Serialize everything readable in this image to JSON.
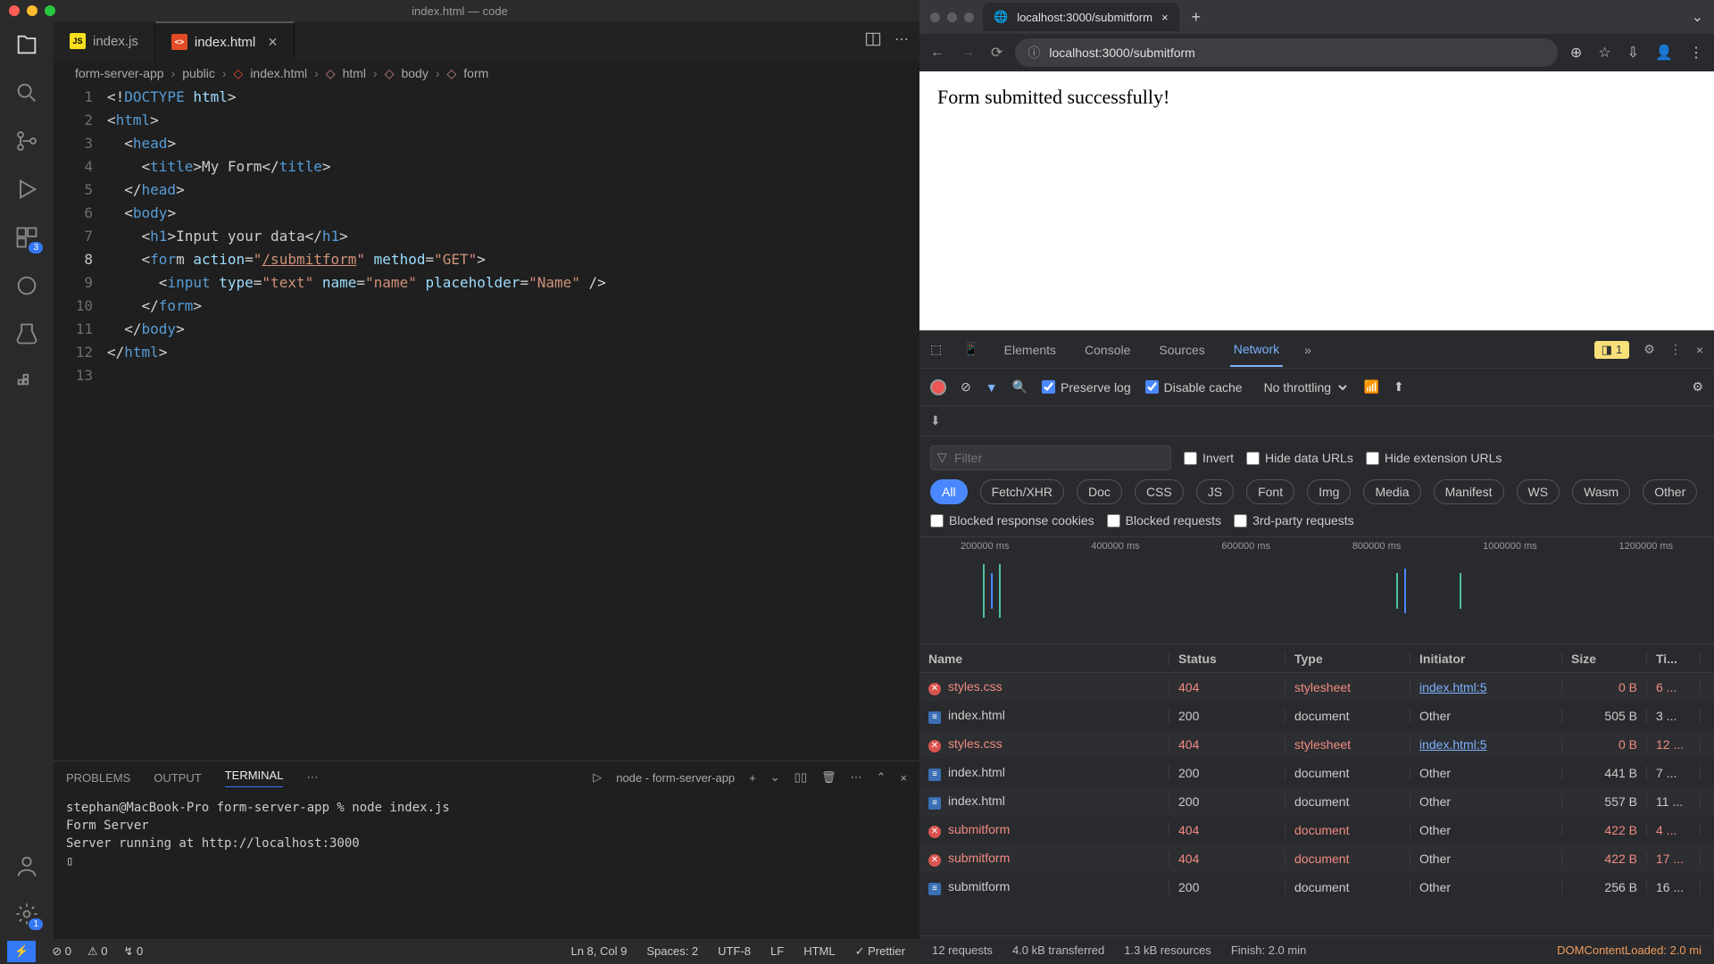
{
  "vscode": {
    "title": "index.html — code",
    "tabs": [
      {
        "icon": "js",
        "label": "index.js",
        "active": false
      },
      {
        "icon": "html",
        "label": "index.html",
        "active": true
      }
    ],
    "breadcrumb": [
      "form-server-app",
      "public",
      "index.html",
      "html",
      "body",
      "form"
    ],
    "code_lines": [
      "1",
      "2",
      "3",
      "4",
      "5",
      "6",
      "7",
      "8",
      "9",
      "10",
      "11",
      "12",
      "13"
    ],
    "panel_tabs": [
      "PROBLEMS",
      "OUTPUT",
      "TERMINAL",
      "⋯"
    ],
    "terminal_label": "node - form-server-app",
    "terminal_text": "stephan@MacBook-Pro form-server-app % node index.js\nForm Server\nServer running at http://localhost:3000\n▯",
    "status_left": {
      "errors": "0",
      "warnings": "0",
      "ports": "0"
    },
    "status_right": {
      "pos": "Ln 8, Col 9",
      "spaces": "Spaces: 2",
      "enc": "UTF-8",
      "eol": "LF",
      "lang": "HTML",
      "prettier": "Prettier"
    },
    "badge_scm": "3",
    "badge_settings": "1"
  },
  "browser": {
    "tab_title": "localhost:3000/submitform",
    "url": "localhost:3000/submitform",
    "content": "Form submitted successfully!"
  },
  "devtools": {
    "tabs": [
      "Elements",
      "Console",
      "Sources",
      "Network"
    ],
    "active_tab": "Network",
    "msg_count": "1",
    "preserve_log": "Preserve log",
    "disable_cache": "Disable cache",
    "throttling": "No throttling",
    "filter_placeholder": "Filter",
    "filter_opts": [
      "Invert",
      "Hide data URLs",
      "Hide extension URLs"
    ],
    "types": [
      "All",
      "Fetch/XHR",
      "Doc",
      "CSS",
      "JS",
      "Font",
      "Img",
      "Media",
      "Manifest",
      "WS",
      "Wasm",
      "Other"
    ],
    "blocked_opts": [
      "Blocked response cookies",
      "Blocked requests",
      "3rd-party requests"
    ],
    "timeline_marks": [
      "200000 ms",
      "400000 ms",
      "600000 ms",
      "800000 ms",
      "1000000 ms",
      "1200000 ms"
    ],
    "columns": [
      "Name",
      "Status",
      "Type",
      "Initiator",
      "Size",
      "Ti..."
    ],
    "rows": [
      {
        "name": "styles.css",
        "status": "404",
        "type": "stylesheet",
        "initiator": "index.html:5",
        "size": "0 B",
        "time": "6 ...",
        "err": true
      },
      {
        "name": "index.html",
        "status": "200",
        "type": "document",
        "initiator": "Other",
        "size": "505 B",
        "time": "3 ...",
        "err": false
      },
      {
        "name": "styles.css",
        "status": "404",
        "type": "stylesheet",
        "initiator": "index.html:5",
        "size": "0 B",
        "time": "12 ...",
        "err": true
      },
      {
        "name": "index.html",
        "status": "200",
        "type": "document",
        "initiator": "Other",
        "size": "441 B",
        "time": "7 ...",
        "err": false
      },
      {
        "name": "index.html",
        "status": "200",
        "type": "document",
        "initiator": "Other",
        "size": "557 B",
        "time": "11 ...",
        "err": false
      },
      {
        "name": "submitform",
        "status": "404",
        "type": "document",
        "initiator": "Other",
        "size": "422 B",
        "time": "4 ...",
        "err": true
      },
      {
        "name": "submitform",
        "status": "404",
        "type": "document",
        "initiator": "Other",
        "size": "422 B",
        "time": "17 ...",
        "err": true
      },
      {
        "name": "submitform",
        "status": "200",
        "type": "document",
        "initiator": "Other",
        "size": "256 B",
        "time": "16 ...",
        "err": false
      }
    ],
    "status": {
      "requests": "12 requests",
      "transferred": "4.0 kB transferred",
      "resources": "1.3 kB resources",
      "finish": "Finish: 2.0 min",
      "dom": "DOMContentLoaded: 2.0 mi"
    }
  }
}
